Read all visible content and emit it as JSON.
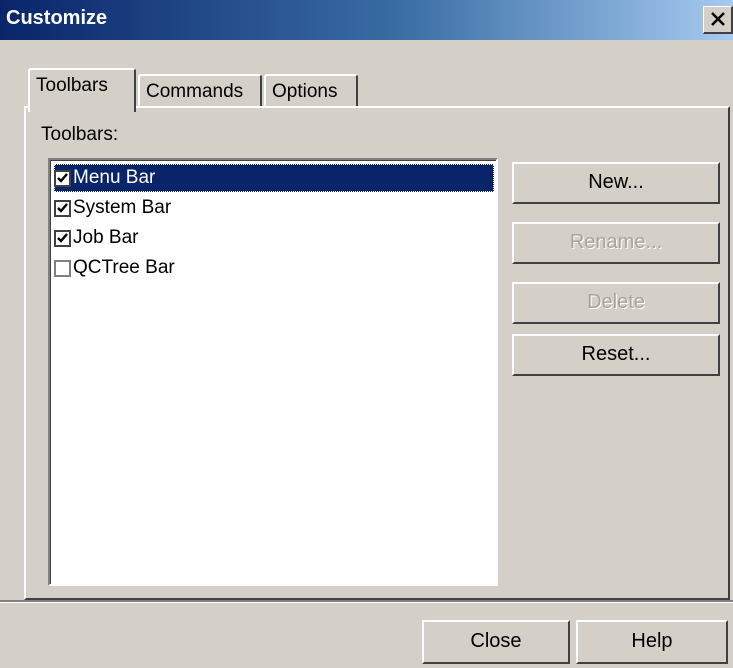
{
  "window": {
    "title": "Customize"
  },
  "tabs": [
    {
      "label": "Toolbars",
      "active": true
    },
    {
      "label": "Commands",
      "active": false
    },
    {
      "label": "Options",
      "active": false
    }
  ],
  "panel": {
    "heading": "Toolbars:",
    "items": [
      {
        "label": "Menu Bar",
        "checked": true,
        "selected": true
      },
      {
        "label": "System Bar",
        "checked": true,
        "selected": false
      },
      {
        "label": "Job Bar",
        "checked": true,
        "selected": false
      },
      {
        "label": "QCTree Bar",
        "checked": false,
        "selected": false
      }
    ],
    "buttons": {
      "new": {
        "label": "New...",
        "enabled": true
      },
      "rename": {
        "label": "Rename...",
        "enabled": false
      },
      "delete": {
        "label": "Delete",
        "enabled": false
      },
      "reset": {
        "label": "Reset...",
        "enabled": true
      }
    }
  },
  "footer": {
    "close": "Close",
    "help": "Help"
  },
  "colors": {
    "title_bar": "#0a246a",
    "selection": "#0a246a",
    "face": "#d4d0c8"
  }
}
